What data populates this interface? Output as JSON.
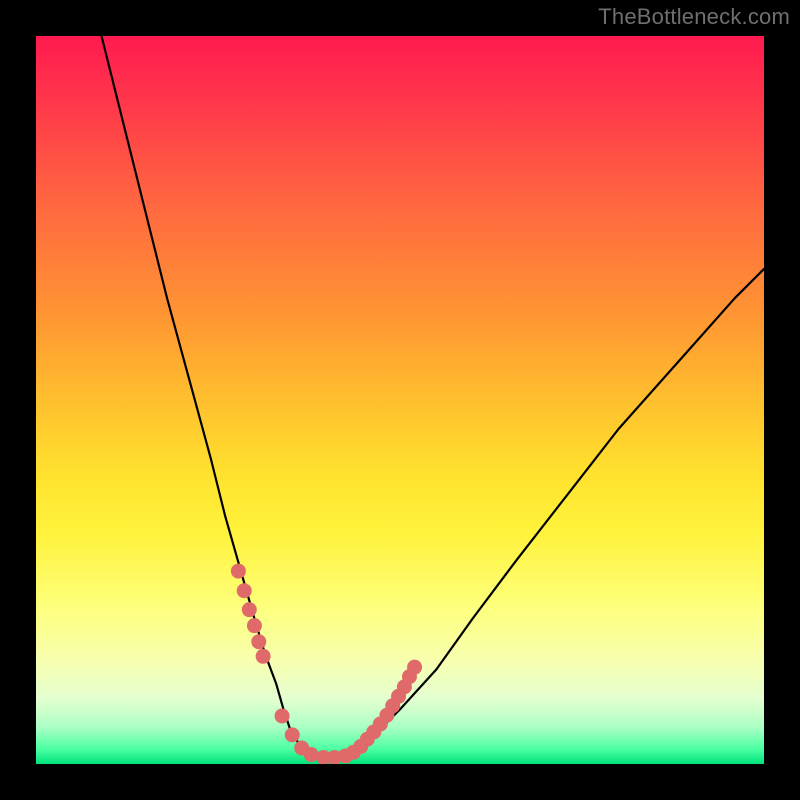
{
  "watermark": "TheBottleneck.com",
  "chart_data": {
    "type": "line",
    "title": "",
    "xlabel": "",
    "ylabel": "",
    "xlim": [
      0,
      100
    ],
    "ylim": [
      0,
      100
    ],
    "grid": false,
    "legend": false,
    "series": [
      {
        "name": "bottleneck-curve",
        "x": [
          9,
          12,
          15,
          18,
          21,
          24,
          26,
          28,
          30,
          31.5,
          33,
          34,
          35,
          36.5,
          38.5,
          42,
          46,
          50,
          55,
          60,
          66,
          73,
          80,
          88,
          96,
          100
        ],
        "y": [
          100,
          88,
          76,
          64,
          53,
          42,
          34,
          27,
          20,
          15,
          11,
          7.5,
          4.5,
          2.2,
          1.0,
          1.0,
          3.5,
          7.5,
          13,
          20,
          28,
          37,
          46,
          55,
          64,
          68
        ]
      }
    ],
    "markers": {
      "name": "highlight-dots",
      "color": "#e06a6a",
      "x": [
        27.8,
        28.6,
        29.3,
        30.0,
        30.6,
        31.2,
        33.8,
        35.2,
        36.5,
        37.8,
        39.5,
        41.0,
        42.5,
        43.6,
        44.6,
        45.5,
        46.4,
        47.3,
        48.2,
        49.0,
        49.8,
        50.6,
        51.3,
        52.0
      ],
      "y": [
        26.5,
        23.8,
        21.2,
        19.0,
        16.8,
        14.8,
        6.6,
        4.0,
        2.2,
        1.3,
        0.9,
        0.9,
        1.1,
        1.6,
        2.4,
        3.4,
        4.4,
        5.5,
        6.7,
        8.0,
        9.3,
        10.6,
        12.0,
        13.3
      ]
    },
    "gradient_stops": [
      {
        "pos": 0.0,
        "color": "#ff1a4f"
      },
      {
        "pos": 0.24,
        "color": "#ff6a3f"
      },
      {
        "pos": 0.5,
        "color": "#ffbf2e"
      },
      {
        "pos": 0.68,
        "color": "#fff23a"
      },
      {
        "pos": 0.86,
        "color": "#f7ffb0"
      },
      {
        "pos": 0.95,
        "color": "#a9ffc4"
      },
      {
        "pos": 1.0,
        "color": "#00e27a"
      }
    ]
  }
}
